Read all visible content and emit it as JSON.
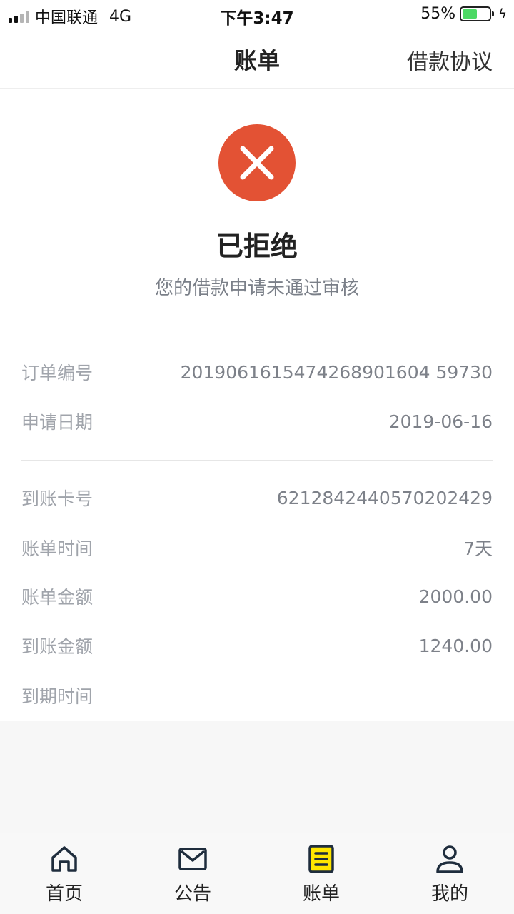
{
  "status_bar": {
    "carrier": "中国联通",
    "network": "4G",
    "time": "下午3:47",
    "battery": "55%",
    "battery_level": 0.55,
    "battery_color": "#4cd964"
  },
  "nav": {
    "title": "账单",
    "right_link": "借款协议"
  },
  "result": {
    "icon": "close-icon",
    "icon_color": "#e35234",
    "title": "已拒绝",
    "description": "您的借款申请未通过审核"
  },
  "order": {
    "rows": [
      {
        "label": "订单编号",
        "value": "2019061615474268901604 59730"
      },
      {
        "label": "申请日期",
        "value": "2019-06-16"
      }
    ]
  },
  "details": {
    "rows": [
      {
        "label": "到账卡号",
        "value": "6212842440570202429"
      },
      {
        "label": "账单时间",
        "value": "7天"
      },
      {
        "label": "账单金额",
        "value": "2000.00"
      },
      {
        "label": "到账金额",
        "value": "1240.00"
      },
      {
        "label": "到期时间",
        "value": ""
      }
    ]
  },
  "tabbar": {
    "items": [
      {
        "label": "首页",
        "icon": "home-icon"
      },
      {
        "label": "公告",
        "icon": "mail-icon"
      },
      {
        "label": "账单",
        "icon": "bill-icon",
        "active": true
      },
      {
        "label": "我的",
        "icon": "user-icon"
      }
    ],
    "active_color": "#ffe600"
  }
}
